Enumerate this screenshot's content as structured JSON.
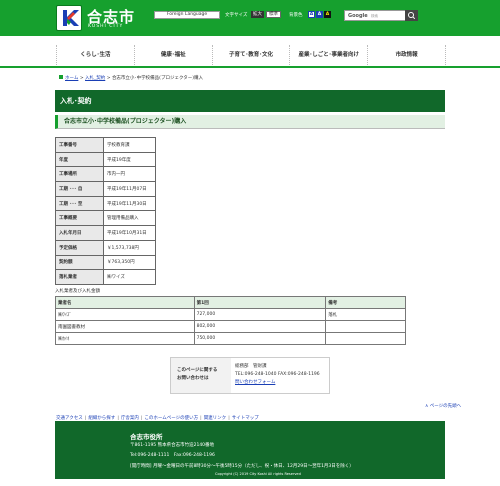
{
  "header": {
    "site_name": "合志市",
    "site_name_en": "KOSHI CITY",
    "language_select": "Foreign Language",
    "font_size_label": "文字サイズ",
    "font_size_large": "拡大",
    "font_size_standard": "標準",
    "bg_color_label": "背景色",
    "bg_options": [
      "A",
      "A",
      "A"
    ],
    "search_brand": "Google",
    "search_sub": "検索"
  },
  "nav": {
    "items": [
      "くらし･生活",
      "健康･福祉",
      "子育て･教育･文化",
      "産業･しごと･事業者向け",
      "市政情報"
    ]
  },
  "breadcrumb": {
    "home": "ホーム",
    "sep1": ">",
    "level1": "入札_契約",
    "sep2": ">",
    "current": "合志市立小･中学校備品(プロジェクター)購入"
  },
  "page_title": "入札･契約",
  "sub_title": "合志市立小･中学校備品(プロジェクター)購入",
  "info_table": [
    {
      "label": "工事番号",
      "value": "学校教育課"
    },
    {
      "label": "年度",
      "value": "平成19年度"
    },
    {
      "label": "工事場所",
      "value": "市内一円"
    },
    {
      "label": "工期 ･･･ 自",
      "value": "平成19年11月07日"
    },
    {
      "label": "工期 ･･･ 至",
      "value": "平成19年11月30日"
    },
    {
      "label": "工事概要",
      "value": "管理用備品購入"
    },
    {
      "label": "入札年月日",
      "value": "平成19年10月31日"
    },
    {
      "label": "予定価格",
      "value": "￥1,573,738円"
    },
    {
      "label": "契約額",
      "value": "￥763,350円"
    },
    {
      "label": "落札業者",
      "value": "㈱ワイズ"
    }
  ],
  "bid_table": {
    "caption": "入札業者及び入札金額",
    "headers": [
      "業者名",
      "第1回",
      "備考"
    ],
    "rows": [
      [
        "㈱ﾜｲｽﾞ",
        "727,000",
        "落札"
      ],
      [
        "南園図書教材",
        "802,000",
        ""
      ],
      [
        "㈱ｶｲﾈ",
        "750,000",
        ""
      ]
    ]
  },
  "contact": {
    "label_line1": "このページに関する",
    "label_line2": "お問い合わせは",
    "dept": "総務部　管財課",
    "phone": "TEL:096-248-1040 FAX:096-248-1196",
    "form_link": "問い合わせフォーム"
  },
  "page_top": "∧ ページの先頭へ",
  "footer_links": [
    "交通アクセス",
    "組織から探す",
    "庁舎案内",
    "このホームページの使い方",
    "関連リンク",
    "サイトマップ"
  ],
  "footer": {
    "office_name": "合志市役所",
    "address": "〒861-1195 熊本県合志市竹迫2140番地",
    "tel": "Tel:096-248-1111　Fax:096-248-1196",
    "hours": "[開庁時間] 月曜～金曜日の午前8時30分～午後5時15分（ただし、祝・休日、12月29日～翌年1月3日を除く）",
    "copyright": "Copyright (C) 2019 City Koshi All rights Reserved"
  },
  "colors": {
    "brand_green": "#16a02e",
    "dark_green": "#11682a",
    "light_green": "#e2f0e3",
    "link_blue": "#1a3fb5"
  }
}
